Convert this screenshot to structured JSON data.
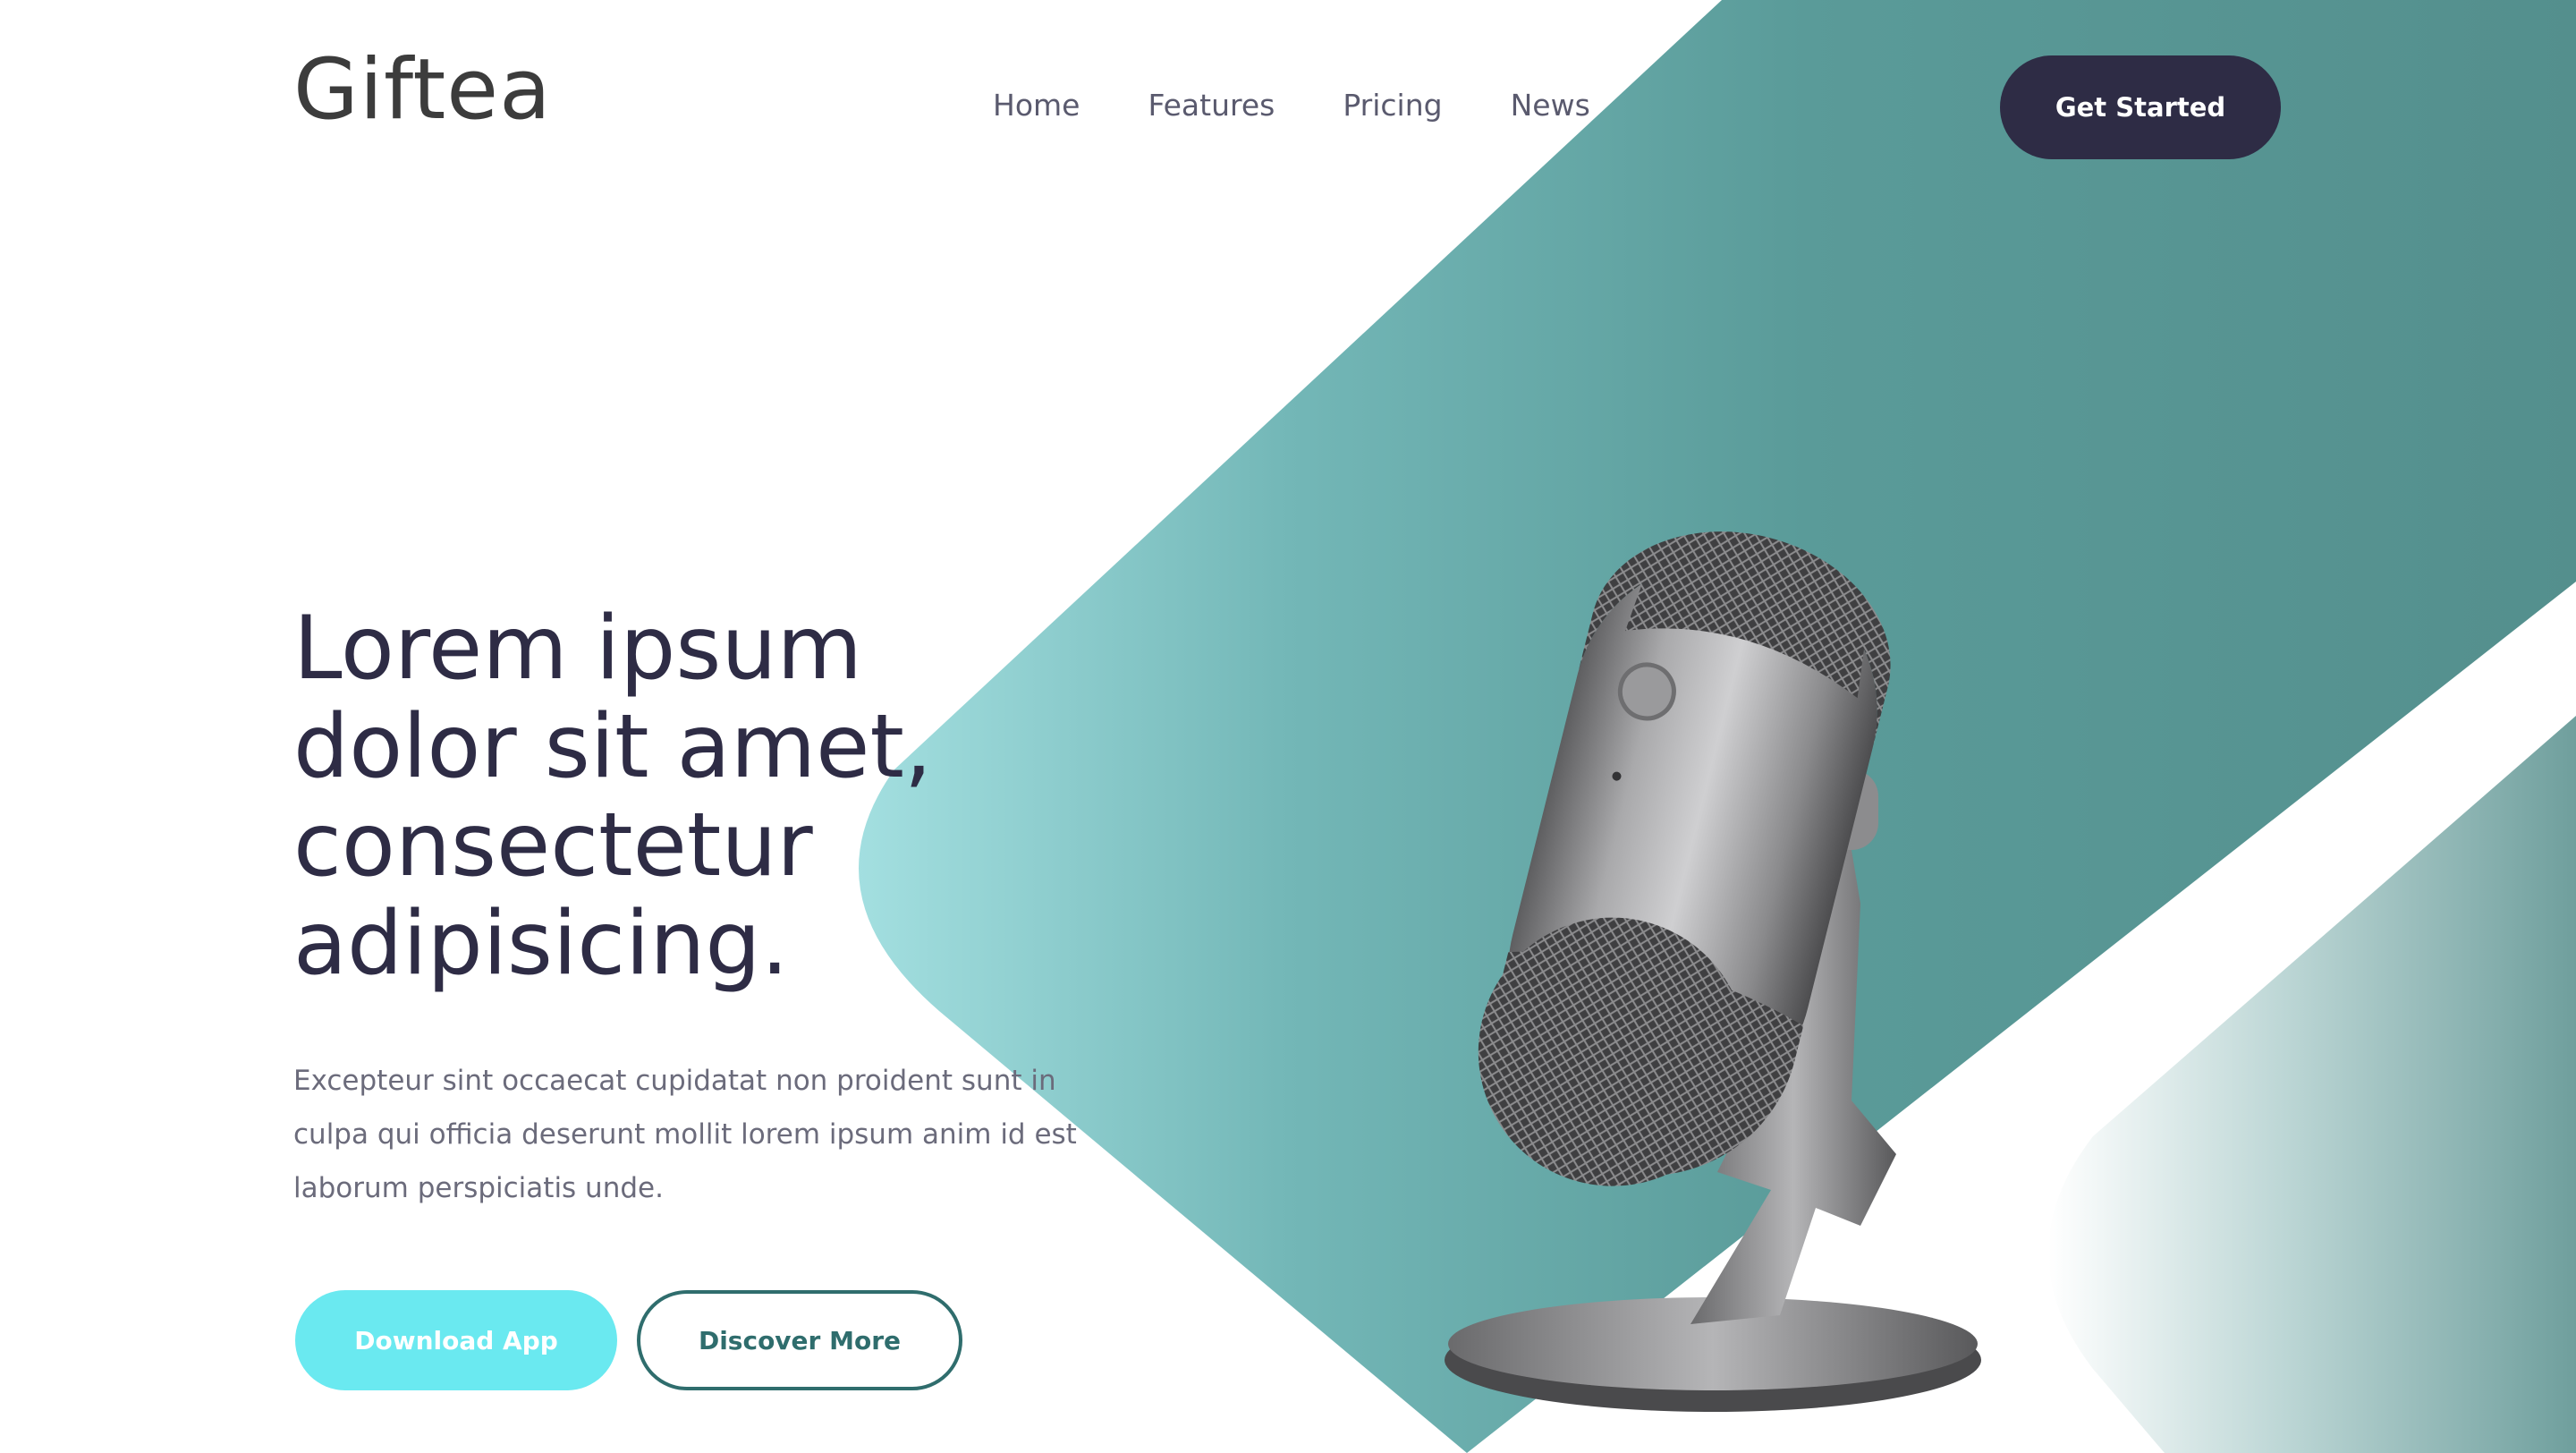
{
  "brand": {
    "logo_text": "Giftea"
  },
  "nav": {
    "items": [
      {
        "label": "Home"
      },
      {
        "label": "Features"
      },
      {
        "label": "Pricing"
      },
      {
        "label": "News"
      }
    ],
    "cta_label": "Get Started"
  },
  "hero": {
    "headline": [
      "Lorem ipsum",
      "dolor sit amet,",
      "consectetur",
      "adipisicing."
    ],
    "subtext": "Excepteur sint occaecat cupidatat non proident sunt in culpa qui officia deserunt mollit lorem ipsum anim id est laborum perspiciatis unde.",
    "primary_button": "Download App",
    "secondary_button": "Discover More"
  },
  "colors": {
    "dark": "#2e2c45",
    "teal": "#5a9593",
    "teal_light": "#9fdadb",
    "accent": "#6ae9f0",
    "outline": "#2f6d6d"
  },
  "icons": {
    "product": "microphone-image"
  }
}
